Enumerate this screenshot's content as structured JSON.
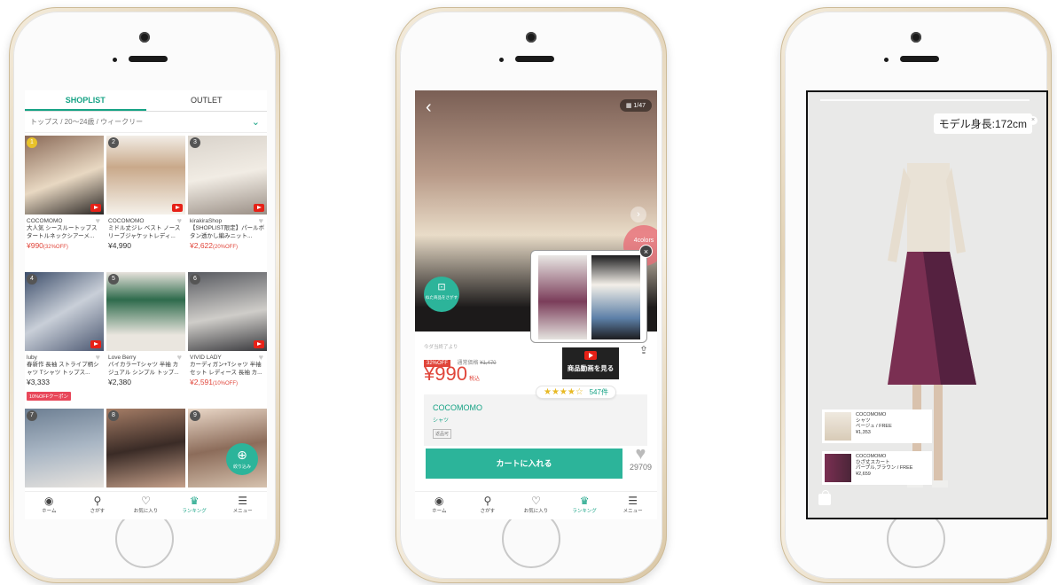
{
  "phone1": {
    "tabs": [
      "SHOPLIST",
      "OUTLET"
    ],
    "filter": "トップス / 20〜24歳 / ウィークリー",
    "products": [
      {
        "rank": "1",
        "shop": "COCOMOMO",
        "title": "大人気 シースルートップス タートルネックシアーメ...",
        "price": "¥990",
        "note": "(32%OFF)",
        "sale": true,
        "coupon": ""
      },
      {
        "rank": "2",
        "shop": "COCOMOMO",
        "title": "ミドル丈ジレ ベスト ノースリーブジャケットレディ...",
        "price": "¥4,990",
        "note": "",
        "sale": false,
        "coupon": ""
      },
      {
        "rank": "3",
        "shop": "kirakiraShop",
        "title": "【SHOPLIST限定】パールボタン透かし編みニット...",
        "price": "¥2,622",
        "note": "(20%OFF)",
        "sale": true,
        "coupon": ""
      },
      {
        "rank": "4",
        "shop": "luby",
        "title": "春新作 長袖 ストライプ柄シャツ Tシャツ トップス...",
        "price": "¥3,333",
        "note": "",
        "sale": false,
        "coupon": "10%OFFクーポン"
      },
      {
        "rank": "5",
        "shop": "Love Berry",
        "title": "バイカラーTシャツ 半袖 カジュアル シンプル トップ...",
        "price": "¥2,380",
        "note": "",
        "sale": false,
        "coupon": ""
      },
      {
        "rank": "6",
        "shop": "VIVID LADY",
        "title": "カーディガン+Tシャツ 半袖セット レディース 長袖 カ...",
        "price": "¥2,591",
        "note": "(10%OFF)",
        "sale": true,
        "coupon": ""
      },
      {
        "rank": "7",
        "shop": "",
        "title": "",
        "price": "",
        "note": "",
        "sale": false,
        "coupon": ""
      },
      {
        "rank": "8",
        "shop": "",
        "title": "",
        "price": "",
        "note": "",
        "sale": false,
        "coupon": ""
      },
      {
        "rank": "9",
        "shop": "",
        "title": "",
        "price": "",
        "note": "",
        "sale": false,
        "coupon": ""
      }
    ],
    "narrow_label": "絞り込み",
    "nav": [
      "ホーム",
      "さがす",
      "お気に入り",
      "ランキング",
      "メニュー"
    ]
  },
  "phone2": {
    "image_counter": "1/47",
    "colors_badge": "4colors",
    "similar_label": "似た商品をさがす",
    "video_button": "商品動画を見る",
    "shop_note": "今ダ当終了より",
    "off_tag": "32%OFF",
    "regular_label": "通常価格",
    "regular_price": "¥1,470",
    "price": "¥990",
    "tax_label": "税込",
    "stars": "★★★★☆",
    "review_count": "547件",
    "brand": "COCOMOMO",
    "category": "シャツ",
    "tag": "返品可",
    "cart_button": "カートに入れる",
    "fav_count": "29709",
    "nav": [
      "ホーム",
      "さがす",
      "お気に入り",
      "ランキング",
      "メニュー"
    ]
  },
  "phone3": {
    "model_height": "モデル身長:172cm",
    "items": [
      {
        "brand": "COCOMOMO",
        "name": "シャツ",
        "variant": "ベージュ / FREE",
        "price": "¥1,353"
      },
      {
        "brand": "COCOMOMO",
        "name": "ひざ丈スカート",
        "variant": "パープル,ブラウン / FREE",
        "price": "¥2,659"
      }
    ]
  },
  "colors": {
    "accent": "#16a385",
    "sale": "#e0453a",
    "button": "#2cb49a"
  }
}
